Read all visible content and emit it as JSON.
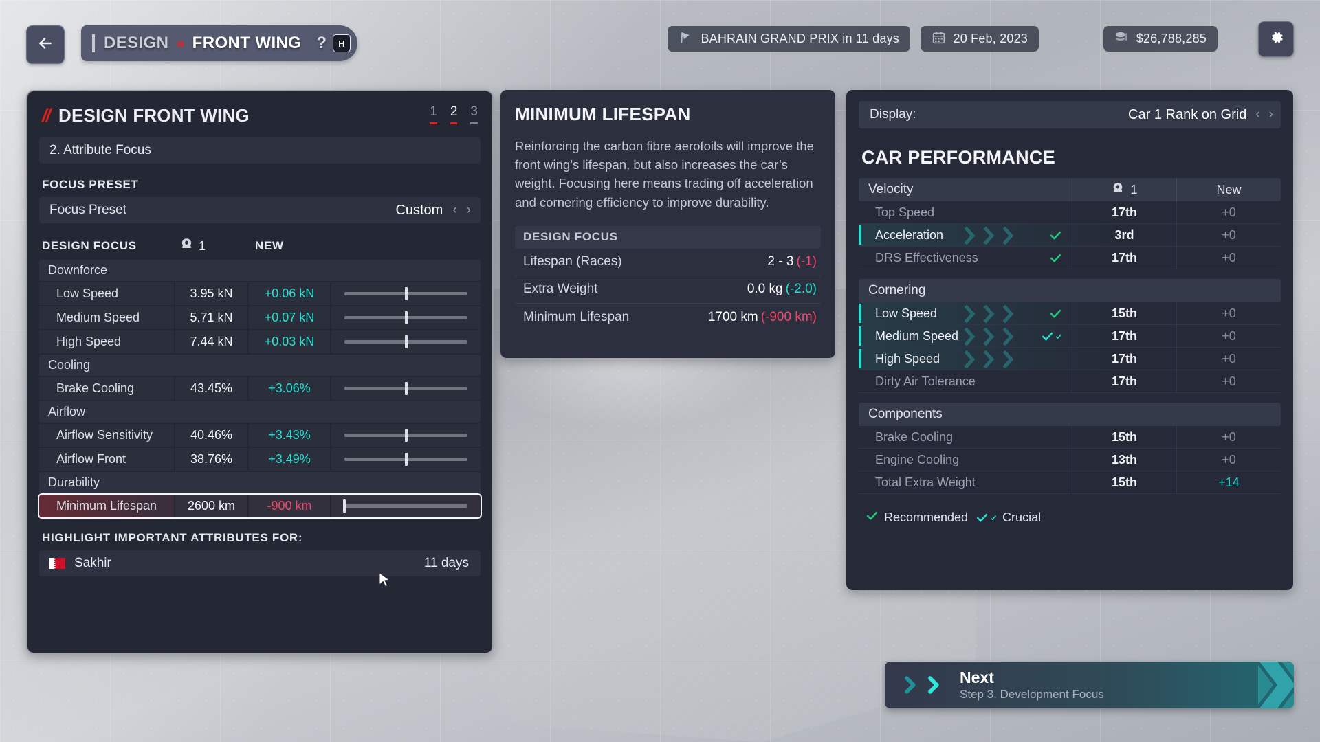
{
  "header": {
    "back_icon": "arrow-left-icon",
    "breadcrumb_section": "DESIGN",
    "breadcrumb_separator": "»",
    "breadcrumb_page": "FRONT WING",
    "help_symbol": "?",
    "help_key": "H",
    "race_chip": "BAHRAIN GRAND PRIX in 11 days",
    "date_chip": "20 Feb, 2023",
    "money_chip": "$26,788,285",
    "settings_icon": "gear-icon"
  },
  "design_panel": {
    "title": "DESIGN FRONT WING",
    "steps": [
      "1",
      "2",
      "3"
    ],
    "active_step": "2",
    "substep": "2. Attribute Focus",
    "focus_preset_label": "FOCUS PRESET",
    "preset_row_label": "Focus Preset",
    "preset_value": "Custom",
    "design_focus_label": "DESIGN FOCUS",
    "car_number": "1",
    "new_column": "NEW",
    "groups": [
      {
        "name": "Downforce",
        "rows": [
          {
            "name": "Low Speed",
            "value": "3.95 kN",
            "delta": "+0.06 kN",
            "delta_sign": "pos",
            "slider": 50
          },
          {
            "name": "Medium Speed",
            "value": "5.71 kN",
            "delta": "+0.07 kN",
            "delta_sign": "pos",
            "slider": 50
          },
          {
            "name": "High Speed",
            "value": "7.44 kN",
            "delta": "+0.03 kN",
            "delta_sign": "pos",
            "slider": 50
          }
        ]
      },
      {
        "name": "Cooling",
        "rows": [
          {
            "name": "Brake Cooling",
            "value": "43.45%",
            "delta": "+3.06%",
            "delta_sign": "pos",
            "slider": 50
          }
        ]
      },
      {
        "name": "Airflow",
        "rows": [
          {
            "name": "Airflow Sensitivity",
            "value": "40.46%",
            "delta": "+3.43%",
            "delta_sign": "pos",
            "slider": 50
          },
          {
            "name": "Airflow Front",
            "value": "38.76%",
            "delta": "+3.49%",
            "delta_sign": "pos",
            "slider": 50
          }
        ]
      },
      {
        "name": "Durability",
        "rows": [
          {
            "name": "Minimum Lifespan",
            "value": "2600 km",
            "delta": "-900 km",
            "delta_sign": "neg",
            "slider": 0,
            "highlight": true
          }
        ]
      }
    ],
    "highlight_label": "HIGHLIGHT IMPORTANT ATTRIBUTES FOR:",
    "track_name": "Sakhir",
    "track_flag": "bahrain-flag-icon",
    "track_days": "11 days"
  },
  "info_panel": {
    "title": "MINIMUM LIFESPAN",
    "description": "Reinforcing the carbon fibre aerofoils will improve the front wing’s lifespan, but also increases the car’s weight. Focusing here means trading off acceleration and cornering efficiency to improve durability.",
    "section_label": "DESIGN FOCUS",
    "rows": [
      {
        "key": "Lifespan (Races)",
        "value": "2 - 3",
        "delta": "(-1)",
        "delta_sign": "neg"
      },
      {
        "key": "Extra Weight",
        "value": "0.0 kg",
        "delta": "(-2.0)",
        "delta_sign": "pos"
      },
      {
        "key": "Minimum Lifespan",
        "value": "1700 km",
        "delta": "(-900 km)",
        "delta_sign": "neg"
      }
    ]
  },
  "performance_panel": {
    "display_label": "Display:",
    "display_value": "Car 1 Rank on Grid",
    "title": "CAR PERFORMANCE",
    "col_car": "1",
    "col_car_icon": "helmet-icon",
    "col_new": "New",
    "groups": [
      {
        "name": "Velocity",
        "rows": [
          {
            "name": "Top Speed",
            "rank": "17th",
            "delta": "+0",
            "delta_sign": "neutral",
            "mark": "none"
          },
          {
            "name": "Acceleration",
            "rank": "3rd",
            "delta": "+0",
            "delta_sign": "neutral",
            "mark": "recommended"
          },
          {
            "name": "DRS Effectiveness",
            "rank": "17th",
            "delta": "+0",
            "delta_sign": "neutral",
            "mark": "tick-only"
          }
        ]
      },
      {
        "name": "Cornering",
        "rows": [
          {
            "name": "Low Speed",
            "rank": "15th",
            "delta": "+0",
            "delta_sign": "neutral",
            "mark": "recommended"
          },
          {
            "name": "Medium Speed",
            "rank": "17th",
            "delta": "+0",
            "delta_sign": "neutral",
            "mark": "crucial"
          },
          {
            "name": "High Speed",
            "rank": "17th",
            "delta": "+0",
            "delta_sign": "neutral",
            "mark": "bar-only"
          },
          {
            "name": "Dirty Air Tolerance",
            "rank": "17th",
            "delta": "+0",
            "delta_sign": "neutral",
            "mark": "none"
          }
        ]
      },
      {
        "name": "Components",
        "rows": [
          {
            "name": "Brake Cooling",
            "rank": "15th",
            "delta": "+0",
            "delta_sign": "neutral",
            "mark": "none"
          },
          {
            "name": "Engine Cooling",
            "rank": "13th",
            "delta": "+0",
            "delta_sign": "neutral",
            "mark": "none"
          },
          {
            "name": "Total Extra Weight",
            "rank": "15th",
            "delta": "+14",
            "delta_sign": "pos",
            "mark": "none"
          }
        ]
      }
    ],
    "legend": [
      {
        "label": "Recommended",
        "mark": "recommended"
      },
      {
        "label": "Crucial",
        "mark": "crucial"
      }
    ]
  },
  "next_button": {
    "title": "Next",
    "subtitle": "Step 3. Development Focus",
    "icon": "double-chevron-right-icon"
  },
  "colors": {
    "accent_red": "#e0201b",
    "accent_cyan": "#25e0d2",
    "negative": "#f0476a",
    "recommend_green": "#20c97e"
  }
}
